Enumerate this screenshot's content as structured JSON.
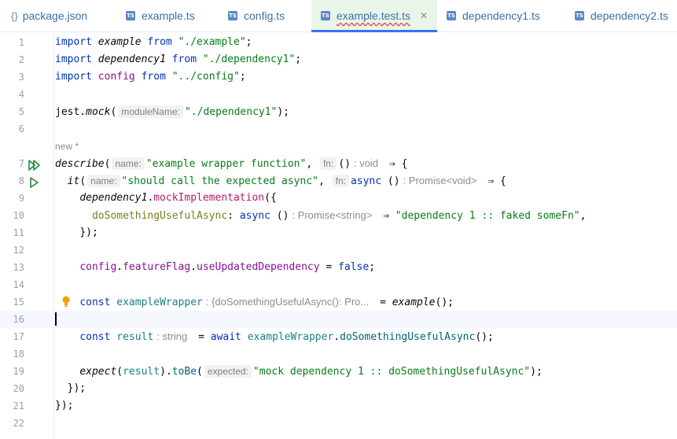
{
  "tabs": [
    {
      "label": "package.json",
      "icon": "json-icon"
    },
    {
      "label": "example.ts",
      "icon": "ts-icon"
    },
    {
      "label": "config.ts",
      "icon": "ts-icon"
    },
    {
      "label": "example.test.ts",
      "icon": "ts-test-icon",
      "active": true
    },
    {
      "label": "dependency1.ts",
      "icon": "ts-icon"
    },
    {
      "label": "dependency2.ts",
      "icon": "ts-icon"
    }
  ],
  "icon_text": {
    "ts": "TS",
    "json": "{}",
    "close": "✕"
  },
  "colors": {
    "keyword": "#0033b3",
    "string": "#067d17",
    "function": "#00627a",
    "property": "#871094",
    "accent": "#3574f0"
  },
  "editor": {
    "current_line": 16,
    "line_numbers": [
      "1",
      "2",
      "3",
      "4",
      "5",
      "6",
      "7",
      "8",
      "9",
      "10",
      "11",
      "12",
      "13",
      "14",
      "15",
      "16",
      "17",
      "18",
      "19",
      "20",
      "21",
      "22"
    ],
    "usage_hint": "new *",
    "l1": {
      "kw1": "import",
      "name": "example",
      "kw2": "from",
      "str": "\"./example\"",
      "end": ";"
    },
    "l2": {
      "kw1": "import",
      "name": "dependency1",
      "kw2": "from",
      "str": "\"./dependency1\"",
      "end": ";"
    },
    "l3": {
      "kw1": "import",
      "name": "config",
      "kw2": "from",
      "str": "\"../config\"",
      "end": ";"
    },
    "l5": {
      "obj": "jest.",
      "fn": "mock",
      "open": "(",
      "hint": "moduleName:",
      "str": "\"./dependency1\"",
      "end": ");"
    },
    "l7": {
      "fn": "describe",
      "open": "(",
      "hint1": "name:",
      "str": "\"example wrapper function\"",
      "comma": ",",
      "hint2": "fn:",
      "paren": "()",
      "type": ": void",
      "arrow": "⇒ {"
    },
    "l8": {
      "indent": "  ",
      "fn": "it",
      "open": "(",
      "hint1": "name:",
      "str": "\"should call the expected async\"",
      "comma": ",",
      "hint2": "fn:",
      "kw": "async",
      "paren": "()",
      "type": ": Promise<void>",
      "arrow": "⇒ {"
    },
    "l9": {
      "indent": "    ",
      "obj": "dependency1",
      "dot": ".",
      "prop": "mockImplementation",
      "end": "({"
    },
    "l10": {
      "indent": "      ",
      "prop": "doSomethingUsefulAsync",
      "colon": ": ",
      "kw": "async",
      "paren": "()",
      "type": ": Promise<string>",
      "arrow": "⇒ ",
      "str": "\"dependency 1 :: faked someFn\"",
      "end": ","
    },
    "l11": {
      "indent": "    ",
      "end": "});"
    },
    "l13": {
      "indent": "    ",
      "obj": "config",
      "dot1": ".",
      "prop1": "featureFlag",
      "dot2": ".",
      "prop2": "useUpdatedDependency",
      "op": " = ",
      "kw": "false",
      "end": ";"
    },
    "l15": {
      "indent": "    ",
      "kw": "const",
      "var": "exampleWrapper",
      "type": ": {doSomethingUsefulAsync(): Pro...",
      "op": "= ",
      "fn": "example",
      "end": "();"
    },
    "l17": {
      "indent": "    ",
      "kw1": "const",
      "var": "result",
      "type": ": string",
      "op": "= ",
      "kw2": "await",
      "obj": "exampleWrapper",
      "dot": ".",
      "fn": "doSomethingUsefulAsync",
      "end": "();"
    },
    "l19": {
      "indent": "    ",
      "fn1": "expect",
      "open": "(",
      "var": "result",
      "close": ").",
      "fn2": "toBe",
      "open2": "(",
      "hint": "expected:",
      "str": "\"mock dependency 1 :: doSomethingUsefulAsync\"",
      "end": ");"
    },
    "l20": {
      "text": "  });"
    },
    "l21": {
      "text": "});"
    }
  }
}
